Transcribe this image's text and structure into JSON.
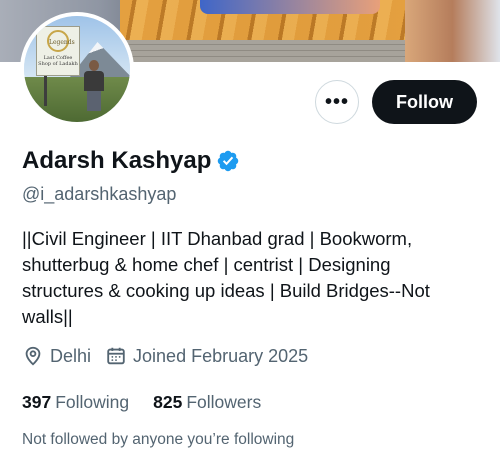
{
  "profile": {
    "display_name": "Adarsh Kashyap",
    "handle": "@i_adarshkashyap",
    "verified": true,
    "avatar_sign": {
      "title": "Legends",
      "subtitle": "Last Coffee Shop of Ladakh"
    },
    "bio_lines": [
      "||Civil Engineer | IIT Dhanbad grad | Bookworm,",
      "shutterbug & home chef | centrist | Designing",
      "structures & cooking up ideas | Build Bridges--Not",
      "walls||"
    ],
    "location": "Delhi",
    "joined": "Joined February 2025",
    "following_count": "397",
    "following_label": "Following",
    "followers_count": "825",
    "followers_label": "Followers",
    "mutual_note": "Not followed by anyone you’re following"
  },
  "actions": {
    "more_label": "•••",
    "follow_label": "Follow"
  },
  "icons": {
    "verified": "verified-badge-icon",
    "location": "location-pin-icon",
    "calendar": "calendar-icon",
    "more": "more-dots-icon"
  },
  "colors": {
    "accent_blue": "#1d9bf0",
    "primary_text": "#0f1419",
    "secondary_text": "#536471",
    "button_dark": "#0f1419",
    "border": "#cfd9de"
  }
}
